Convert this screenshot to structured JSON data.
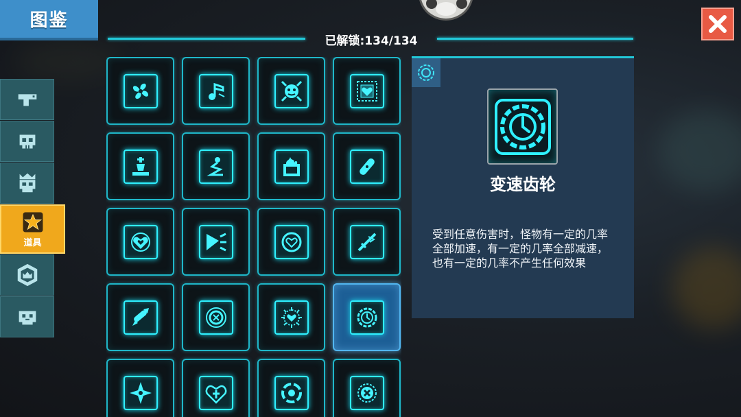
{
  "title": "图鉴",
  "unlock_status": "已解锁:134/134",
  "close_icon": "close-x-icon",
  "categories": [
    {
      "name": "weapons",
      "icon": "gun-icon",
      "label": ""
    },
    {
      "name": "monsters",
      "icon": "skull-icon",
      "label": ""
    },
    {
      "name": "bosses",
      "icon": "crown-skull-icon",
      "label": ""
    },
    {
      "name": "items",
      "icon": "star-icon",
      "label": "道具",
      "active": true
    },
    {
      "name": "badges",
      "icon": "shield-crown-icon",
      "label": ""
    },
    {
      "name": "pets",
      "icon": "pet-icon",
      "label": ""
    }
  ],
  "grid_items": [
    {
      "icon": "propeller-icon"
    },
    {
      "icon": "music-note-icon"
    },
    {
      "icon": "target-face-icon"
    },
    {
      "icon": "heart-frame-icon"
    },
    {
      "icon": "bishop-piece-icon"
    },
    {
      "icon": "zigzag-path-icon"
    },
    {
      "icon": "burning-box-icon"
    },
    {
      "icon": "bandage-icon"
    },
    {
      "icon": "heart-circle-icon"
    },
    {
      "icon": "claw-splash-icon"
    },
    {
      "icon": "heart-ring-icon"
    },
    {
      "icon": "broken-sword-icon"
    },
    {
      "icon": "rocket-bullets-icon"
    },
    {
      "icon": "crosshair-ring-icon"
    },
    {
      "icon": "spiky-heart-icon"
    },
    {
      "icon": "speed-gear-icon",
      "selected": true
    },
    {
      "icon": "four-point-star-icon"
    },
    {
      "icon": "cross-heart-icon"
    },
    {
      "icon": "tri-ring-icon"
    },
    {
      "icon": "x-circle-icon"
    }
  ],
  "detail": {
    "badge_icon": "gear-badge-icon",
    "item_icon": "speed-gear-icon",
    "name": "变速齿轮",
    "description": "受到任意伤害时，怪物有一定的几率全部加速，有一定的几率全部减速，也有一定的几率不产生任何效果"
  },
  "colors": {
    "accent": "#22c8d8",
    "title_tab": "#3e8fca",
    "close": "#e85a44",
    "active_tab": "#f0a81c",
    "panel": "#233a52"
  }
}
